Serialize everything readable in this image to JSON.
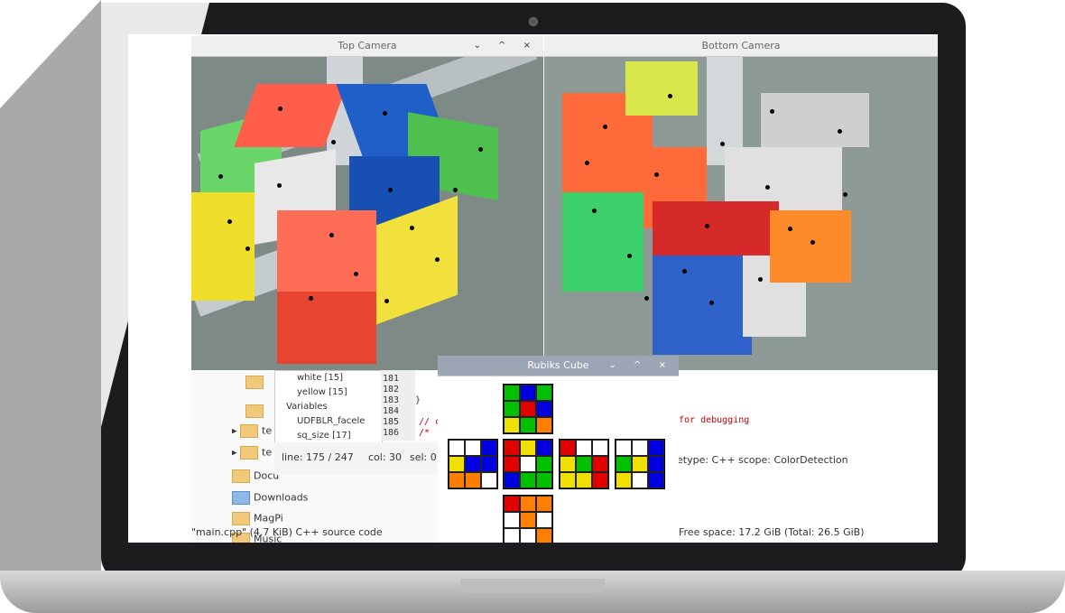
{
  "top_camera": {
    "title": "Top Camera"
  },
  "bottom_camera": {
    "title": "Bottom Camera"
  },
  "window_buttons": "⌄ ^ ×",
  "rubiks_window": {
    "title": "Rubiks Cube"
  },
  "symbols_tree": {
    "items": [
      "white [15]",
      "yellow [15]",
      "Variables",
      "UDFBLR_facele",
      "sq_size [17]"
    ]
  },
  "editor": {
    "line_numbers": [
      "181",
      "182",
      "183",
      "184",
      "185",
      "186"
    ],
    "code_brace": "}",
    "code_comment": "// c",
    "code_comment2": "/*",
    "debug_comment": "for debugging"
  },
  "status": {
    "line": "line: 175 / 247",
    "col": "col: 30",
    "sel": "sel: 0",
    "filetype": "etype: C++",
    "scope": "scope: ColorDetection",
    "file_info": "\"main.cpp\" (4.7 KiB) C++ source code",
    "free_space": "Free space: 17.2 GiB (Total: 26.5 GiB)"
  },
  "file_manager": {
    "items": [
      "te",
      "te",
      "Docu",
      "Downloads",
      "MagPi",
      "Music"
    ]
  },
  "cube_colors": {
    "U": [
      "#00c000",
      "#0000e0",
      "#00c000",
      "#00c000",
      "#e00000",
      "#0000e0",
      "#f0e000",
      "#00c000",
      "#ff8000"
    ],
    "L": [
      "#ffffff",
      "#ffffff",
      "#0000e0",
      "#f0e000",
      "#0000e0",
      "#0000e0",
      "#ff8000",
      "#ff8000",
      "#ffffff"
    ],
    "F": [
      "#e00000",
      "#f0e000",
      "#0000e0",
      "#e00000",
      "#ffffff",
      "#00c000",
      "#0000e0",
      "#00c000",
      "#00c000"
    ],
    "R": [
      "#e00000",
      "#ffffff",
      "#ffffff",
      "#f0e000",
      "#00c000",
      "#e00000",
      "#f0e000",
      "#f0e000",
      "#e00000"
    ],
    "B": [
      "#ffffff",
      "#ffffff",
      "#0000e0",
      "#00c000",
      "#f0e000",
      "#0000e0",
      "#f0e000",
      "#ffffff",
      "#0000e0"
    ],
    "D": [
      "#e00000",
      "#ff8000",
      "#ff8000",
      "#ffffff",
      "#ff8000",
      "#ffffff",
      "#ffffff",
      "#ffffff",
      "#ff8000"
    ]
  }
}
